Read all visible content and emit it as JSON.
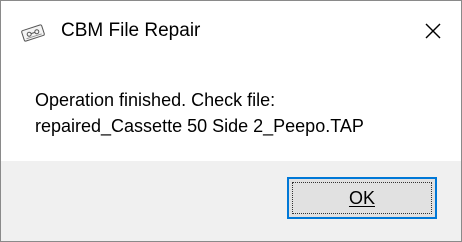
{
  "window": {
    "title": "CBM File Repair",
    "app_icon": "cassette-icon",
    "close_icon": "close-icon"
  },
  "message": {
    "line1": "Operation finished. Check file:",
    "line2": "repaired_Cassette 50 Side 2_Peepo.TAP"
  },
  "buttons": {
    "ok_label": "OK"
  },
  "colors": {
    "focus_border": "#0078d7",
    "button_face": "#e1e1e1",
    "footer_bg": "#f0f0f0"
  }
}
